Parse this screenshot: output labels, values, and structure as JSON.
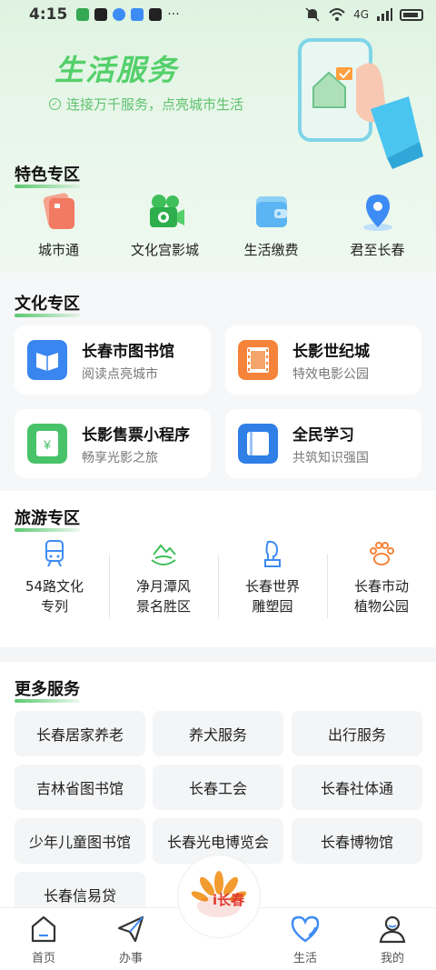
{
  "status_bar": {
    "time": "4:15",
    "dots": "···",
    "network": "4G",
    "colors": {
      "app1": "#34a853",
      "app2": "#222222",
      "app3": "#3d8bf5",
      "app4": "#3d8bf5",
      "app5": "#222222"
    }
  },
  "hero": {
    "title": "生活服务",
    "subtitle": "连接万千服务，点亮城市生活"
  },
  "featured": {
    "title": "特色专区",
    "items": [
      {
        "label": "城市通",
        "icon": "card-icon"
      },
      {
        "label": "文化宫影城",
        "icon": "camera-icon"
      },
      {
        "label": "生活缴费",
        "icon": "wallet-icon"
      },
      {
        "label": "君至长春",
        "icon": "location-pin-icon"
      }
    ]
  },
  "culture": {
    "title": "文化专区",
    "cards": [
      {
        "title": "长春市图书馆",
        "sub": "阅读点亮城市",
        "icon": "book-icon"
      },
      {
        "title": "长影世纪城",
        "sub": "特效电影公园",
        "icon": "film-icon"
      },
      {
        "title": "长影售票小程序",
        "sub": "畅享光影之旅",
        "icon": "ticket-icon"
      },
      {
        "title": "全民学习",
        "sub": "共筑知识强国",
        "icon": "notebook-icon"
      }
    ]
  },
  "tourism": {
    "title": "旅游专区",
    "items": [
      {
        "label": "54路文化\n专列",
        "icon": "tram-icon"
      },
      {
        "label": "净月潭风\n景名胜区",
        "icon": "landscape-icon"
      },
      {
        "label": "长春世界\n雕塑园",
        "icon": "sculpture-icon"
      },
      {
        "label": "长春市动\n植物公园",
        "icon": "paw-icon"
      }
    ]
  },
  "more_services": {
    "title": "更多服务",
    "items": [
      "长春居家养老",
      "养犬服务",
      "出行服务",
      "吉林省图书馆",
      "长春工会",
      "长春社体通",
      "少年儿童图书馆",
      "长春光电博览会",
      "长春博物馆",
      "长春信易贷"
    ]
  },
  "bottom_nav": {
    "items": [
      {
        "label": "首页",
        "icon": "home-icon"
      },
      {
        "label": "办事",
        "icon": "paper-plane-icon"
      },
      {
        "label": "生活",
        "icon": "heart-icon"
      },
      {
        "label": "我的",
        "icon": "user-icon"
      }
    ],
    "center_logo_text": "i长春"
  }
}
